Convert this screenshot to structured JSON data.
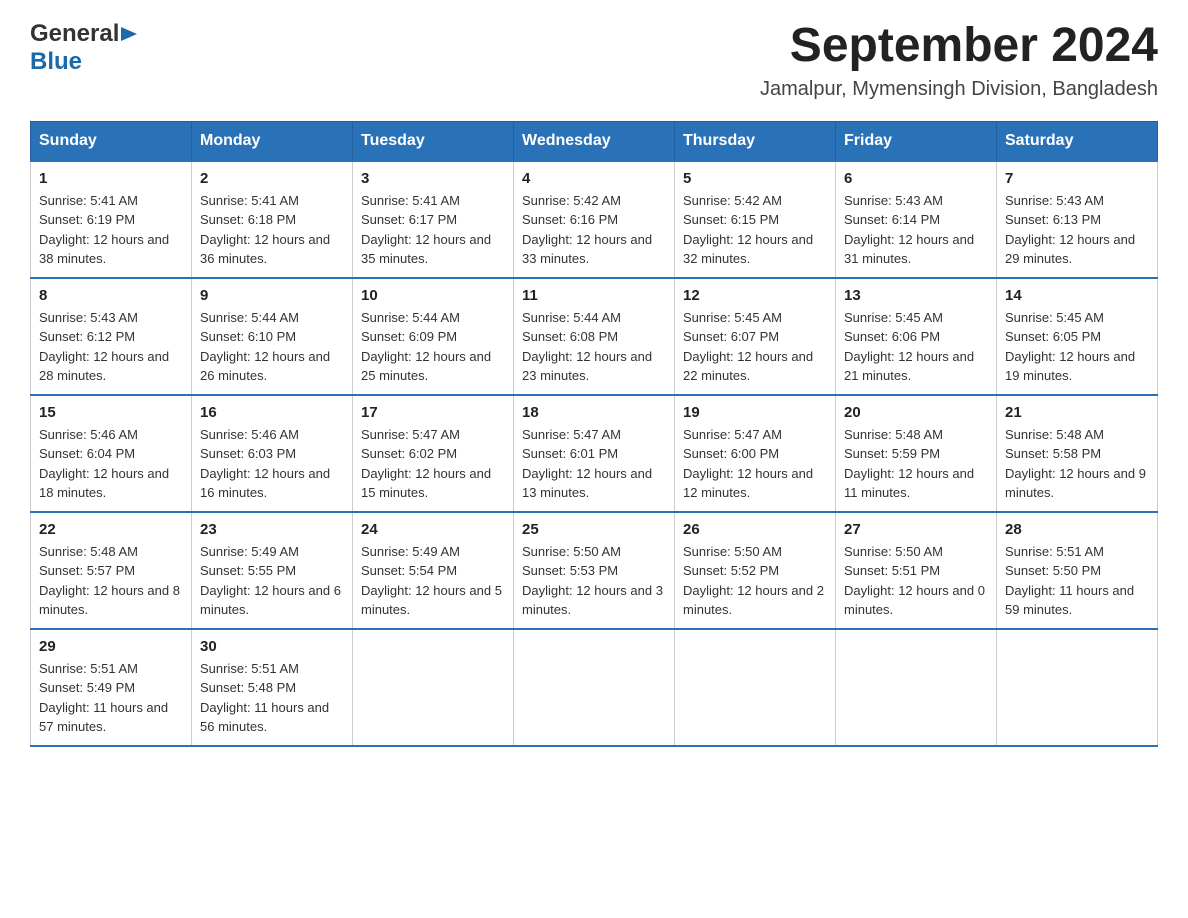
{
  "header": {
    "logo_general": "General",
    "logo_blue": "Blue",
    "month_title": "September 2024",
    "location": "Jamalpur, Mymensingh Division, Bangladesh"
  },
  "calendar": {
    "days_of_week": [
      "Sunday",
      "Monday",
      "Tuesday",
      "Wednesday",
      "Thursday",
      "Friday",
      "Saturday"
    ],
    "weeks": [
      [
        {
          "day": "1",
          "sunrise": "5:41 AM",
          "sunset": "6:19 PM",
          "daylight": "12 hours and 38 minutes."
        },
        {
          "day": "2",
          "sunrise": "5:41 AM",
          "sunset": "6:18 PM",
          "daylight": "12 hours and 36 minutes."
        },
        {
          "day": "3",
          "sunrise": "5:41 AM",
          "sunset": "6:17 PM",
          "daylight": "12 hours and 35 minutes."
        },
        {
          "day": "4",
          "sunrise": "5:42 AM",
          "sunset": "6:16 PM",
          "daylight": "12 hours and 33 minutes."
        },
        {
          "day": "5",
          "sunrise": "5:42 AM",
          "sunset": "6:15 PM",
          "daylight": "12 hours and 32 minutes."
        },
        {
          "day": "6",
          "sunrise": "5:43 AM",
          "sunset": "6:14 PM",
          "daylight": "12 hours and 31 minutes."
        },
        {
          "day": "7",
          "sunrise": "5:43 AM",
          "sunset": "6:13 PM",
          "daylight": "12 hours and 29 minutes."
        }
      ],
      [
        {
          "day": "8",
          "sunrise": "5:43 AM",
          "sunset": "6:12 PM",
          "daylight": "12 hours and 28 minutes."
        },
        {
          "day": "9",
          "sunrise": "5:44 AM",
          "sunset": "6:10 PM",
          "daylight": "12 hours and 26 minutes."
        },
        {
          "day": "10",
          "sunrise": "5:44 AM",
          "sunset": "6:09 PM",
          "daylight": "12 hours and 25 minutes."
        },
        {
          "day": "11",
          "sunrise": "5:44 AM",
          "sunset": "6:08 PM",
          "daylight": "12 hours and 23 minutes."
        },
        {
          "day": "12",
          "sunrise": "5:45 AM",
          "sunset": "6:07 PM",
          "daylight": "12 hours and 22 minutes."
        },
        {
          "day": "13",
          "sunrise": "5:45 AM",
          "sunset": "6:06 PM",
          "daylight": "12 hours and 21 minutes."
        },
        {
          "day": "14",
          "sunrise": "5:45 AM",
          "sunset": "6:05 PM",
          "daylight": "12 hours and 19 minutes."
        }
      ],
      [
        {
          "day": "15",
          "sunrise": "5:46 AM",
          "sunset": "6:04 PM",
          "daylight": "12 hours and 18 minutes."
        },
        {
          "day": "16",
          "sunrise": "5:46 AM",
          "sunset": "6:03 PM",
          "daylight": "12 hours and 16 minutes."
        },
        {
          "day": "17",
          "sunrise": "5:47 AM",
          "sunset": "6:02 PM",
          "daylight": "12 hours and 15 minutes."
        },
        {
          "day": "18",
          "sunrise": "5:47 AM",
          "sunset": "6:01 PM",
          "daylight": "12 hours and 13 minutes."
        },
        {
          "day": "19",
          "sunrise": "5:47 AM",
          "sunset": "6:00 PM",
          "daylight": "12 hours and 12 minutes."
        },
        {
          "day": "20",
          "sunrise": "5:48 AM",
          "sunset": "5:59 PM",
          "daylight": "12 hours and 11 minutes."
        },
        {
          "day": "21",
          "sunrise": "5:48 AM",
          "sunset": "5:58 PM",
          "daylight": "12 hours and 9 minutes."
        }
      ],
      [
        {
          "day": "22",
          "sunrise": "5:48 AM",
          "sunset": "5:57 PM",
          "daylight": "12 hours and 8 minutes."
        },
        {
          "day": "23",
          "sunrise": "5:49 AM",
          "sunset": "5:55 PM",
          "daylight": "12 hours and 6 minutes."
        },
        {
          "day": "24",
          "sunrise": "5:49 AM",
          "sunset": "5:54 PM",
          "daylight": "12 hours and 5 minutes."
        },
        {
          "day": "25",
          "sunrise": "5:50 AM",
          "sunset": "5:53 PM",
          "daylight": "12 hours and 3 minutes."
        },
        {
          "day": "26",
          "sunrise": "5:50 AM",
          "sunset": "5:52 PM",
          "daylight": "12 hours and 2 minutes."
        },
        {
          "day": "27",
          "sunrise": "5:50 AM",
          "sunset": "5:51 PM",
          "daylight": "12 hours and 0 minutes."
        },
        {
          "day": "28",
          "sunrise": "5:51 AM",
          "sunset": "5:50 PM",
          "daylight": "11 hours and 59 minutes."
        }
      ],
      [
        {
          "day": "29",
          "sunrise": "5:51 AM",
          "sunset": "5:49 PM",
          "daylight": "11 hours and 57 minutes."
        },
        {
          "day": "30",
          "sunrise": "5:51 AM",
          "sunset": "5:48 PM",
          "daylight": "11 hours and 56 minutes."
        },
        null,
        null,
        null,
        null,
        null
      ]
    ]
  }
}
